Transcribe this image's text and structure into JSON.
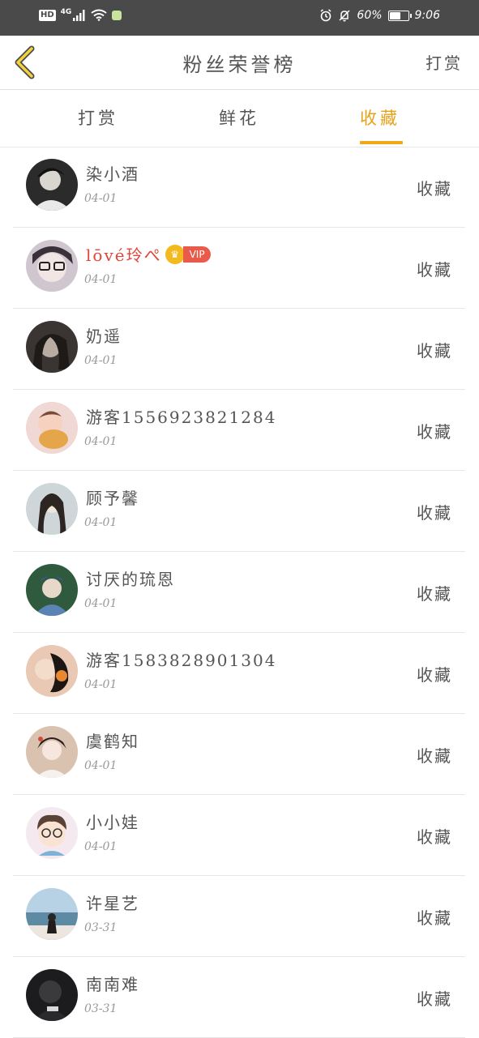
{
  "status_bar": {
    "hd": "HD",
    "signal": "4G",
    "battery_pct": "60%",
    "battery_level": 0.6,
    "time": "9:06"
  },
  "header": {
    "back_icon": "chevron-left-icon",
    "title": "粉丝荣誉榜",
    "action": "打赏"
  },
  "tabs": [
    {
      "label": "打赏",
      "active": false
    },
    {
      "label": "鲜花",
      "active": false
    },
    {
      "label": "收藏",
      "active": true
    }
  ],
  "accent_color": "#f0a81a",
  "list": [
    {
      "name": "染小酒",
      "date": "04-01",
      "action": "收藏"
    },
    {
      "name": "lōvé玲ぺ",
      "date": "04-01",
      "action": "收藏",
      "vip": "VIP"
    },
    {
      "name": "奶遥",
      "date": "04-01",
      "action": "收藏"
    },
    {
      "name": "游客1556923821284",
      "date": "04-01",
      "action": "收藏"
    },
    {
      "name": "顾予馨",
      "date": "04-01",
      "action": "收藏"
    },
    {
      "name": "讨厌的琉恩",
      "date": "04-01",
      "action": "收藏"
    },
    {
      "name": "游客1583828901304",
      "date": "04-01",
      "action": "收藏"
    },
    {
      "name": "虞鹤知",
      "date": "04-01",
      "action": "收藏"
    },
    {
      "name": "小小娃",
      "date": "04-01",
      "action": "收藏"
    },
    {
      "name": "许星艺",
      "date": "03-31",
      "action": "收藏"
    },
    {
      "name": "南南难",
      "date": "03-31",
      "action": "收藏"
    }
  ]
}
